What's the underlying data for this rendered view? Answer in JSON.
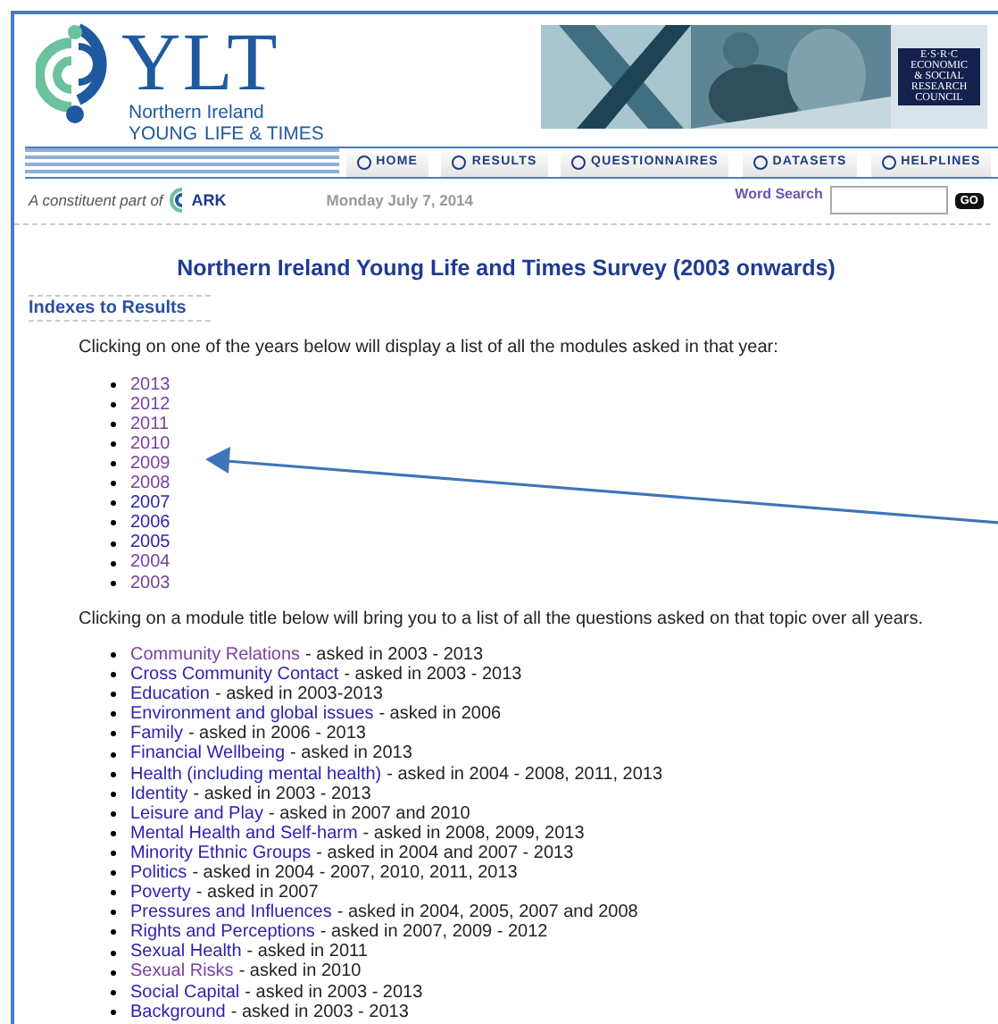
{
  "header": {
    "logo": {
      "mark": "YLT",
      "line1": "Northern Ireland",
      "line2a": "YOUNG",
      "line2b": "LIFE & TIMES"
    },
    "partner_logo": [
      "E·S·R·C",
      "ECONOMIC",
      "& SOCIAL",
      "RESEARCH",
      "COUNCIL"
    ]
  },
  "nav": [
    {
      "label": "HOME"
    },
    {
      "label": "RESULTS"
    },
    {
      "label": "QUESTIONNAIRES"
    },
    {
      "label": "DATASETS"
    },
    {
      "label": "HELPLINES"
    }
  ],
  "subbar": {
    "tagline": "A constituent part of",
    "ark_logo": "ARK",
    "date": "Monday July 7, 2014",
    "search_label": "Word Search",
    "go_button": "GO"
  },
  "title": "Northern Ireland Young Life and Times Survey (2003 onwards)",
  "section_heading": "Indexes to Results",
  "years_intro": "Clicking on one of the years below will display a list of all the modules asked in that year:",
  "years": [
    {
      "label": "2013",
      "visited": true
    },
    {
      "label": "2012",
      "visited": true
    },
    {
      "label": "2011",
      "visited": true
    },
    {
      "label": "2010",
      "visited": true
    },
    {
      "label": "2009",
      "visited": true
    },
    {
      "label": "2008",
      "visited": true
    },
    {
      "label": "2007",
      "visited": false
    },
    {
      "label": "2006",
      "visited": false
    },
    {
      "label": "2005",
      "visited": false
    },
    {
      "label": "2004",
      "visited": true
    },
    {
      "label": "2003",
      "visited": true
    }
  ],
  "modules_intro": "Clicking on a module title below will bring you to a list of all the questions asked on that topic over all years.",
  "modules": [
    {
      "title": "Community Relations",
      "note": "- asked in 2003 - 2013",
      "visited": true
    },
    {
      "title": "Cross Community Contact",
      "note": "- asked in 2003 - 2013",
      "visited": false
    },
    {
      "title": "Education",
      "note": "- asked in 2003-2013",
      "visited": false
    },
    {
      "title": "Environment and global issues",
      "note": "- asked in 2006",
      "visited": false
    },
    {
      "title": "Family",
      "note": "- asked in 2006 - 2013",
      "visited": false
    },
    {
      "title": "Financial Wellbeing",
      "note": "- asked in 2013",
      "visited": false
    },
    {
      "title": "Health (including mental health)",
      "note": "- asked in 2004 - 2008, 2011, 2013",
      "visited": false
    },
    {
      "title": "Identity",
      "note": "- asked in 2003 - 2013",
      "visited": false
    },
    {
      "title": "Leisure and Play",
      "note": "- asked in 2007 and 2010",
      "visited": false
    },
    {
      "title": "Mental Health and Self-harm",
      "note": "- asked in 2008, 2009, 2013",
      "visited": false
    },
    {
      "title": "Minority Ethnic Groups",
      "note": "- asked in 2004 and 2007 - 2013",
      "visited": false
    },
    {
      "title": "Politics",
      "note": "- asked in 2004 - 2007, 2010, 2011, 2013",
      "visited": false
    },
    {
      "title": "Poverty",
      "note": "- asked in 2007",
      "visited": false
    },
    {
      "title": "Pressures and Influences",
      "note": "- asked in 2004, 2005, 2007 and 2008",
      "visited": false
    },
    {
      "title": "Rights and Perceptions",
      "note": "- asked in 2007, 2009 - 2012",
      "visited": false
    },
    {
      "title": "Sexual Health",
      "note": "- asked in 2011",
      "visited": false
    },
    {
      "title": "Sexual Risks",
      "note": "- asked in 2010",
      "visited": true
    },
    {
      "title": "Social Capital",
      "note": "- asked in 2003 - 2013",
      "visited": false
    },
    {
      "title": "Background",
      "note": "- asked in 2003 - 2013",
      "visited": false
    }
  ]
}
